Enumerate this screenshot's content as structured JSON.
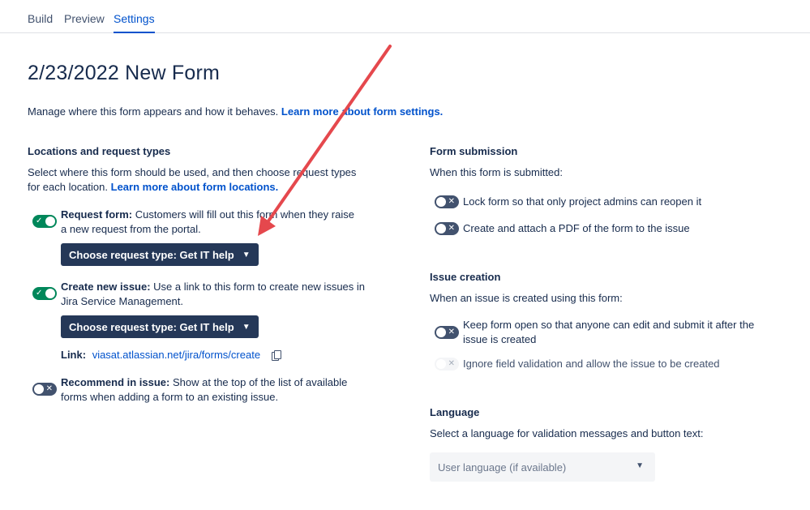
{
  "tabs": [
    {
      "label": "Build",
      "active": false
    },
    {
      "label": "Preview",
      "active": false
    },
    {
      "label": "Settings",
      "active": true
    }
  ],
  "page_title": "2/23/2022 New Form",
  "intro": {
    "text": "Manage where this form appears and how it behaves.",
    "link": "Learn more about form settings."
  },
  "locations": {
    "title": "Locations and request types",
    "description_line1": "Select where this form should be used, and then choose request types",
    "description_line2": "for each location.",
    "description_link": "Learn more about form locations.",
    "request_form": {
      "enabled": true,
      "label": "Request form:",
      "text_line1": "Customers will fill out this form when they raise",
      "text_line2": "a new request from the portal.",
      "button": "Choose request type: Get IT help"
    },
    "create_issue": {
      "enabled": true,
      "label": "Create new issue:",
      "text_line1": "Use a link to this form to create new issues in",
      "text_line2": "Jira Service Management.",
      "button": "Choose request type: Get IT help",
      "link_label": "Link:",
      "link_url": "viasat.atlassian.net/jira/forms/create"
    },
    "recommend": {
      "enabled": false,
      "label": "Recommend in issue:",
      "text_line1": "Show at the top of the list of available",
      "text_line2": "forms when adding a form to an existing issue."
    }
  },
  "submission": {
    "title": "Form submission",
    "description": "When this form is submitted:",
    "options": [
      {
        "label": "Lock form so that only project admins can reopen it",
        "enabled": false
      },
      {
        "label": "Create and attach a PDF of the form to the issue",
        "enabled": false
      }
    ]
  },
  "issue_creation": {
    "title": "Issue creation",
    "description": "When an issue is created using this form:",
    "keep_open_line1": "Keep form open so that anyone can edit and submit it after the",
    "keep_open_line2": "issue is created",
    "ignore_validation": "Ignore field validation and allow the issue to be created"
  },
  "language": {
    "title": "Language",
    "description": "Select a language for validation messages and button text:",
    "selected": "User language (if available)"
  },
  "colors": {
    "accent": "#0052cc",
    "toggle_on": "#00875a",
    "toggle_off": "#42526e",
    "button_dark": "#253858",
    "annotation_arrow": "#e5484d"
  },
  "icons": {
    "check": "✓",
    "cross": "✕",
    "chevron": "⌄"
  }
}
